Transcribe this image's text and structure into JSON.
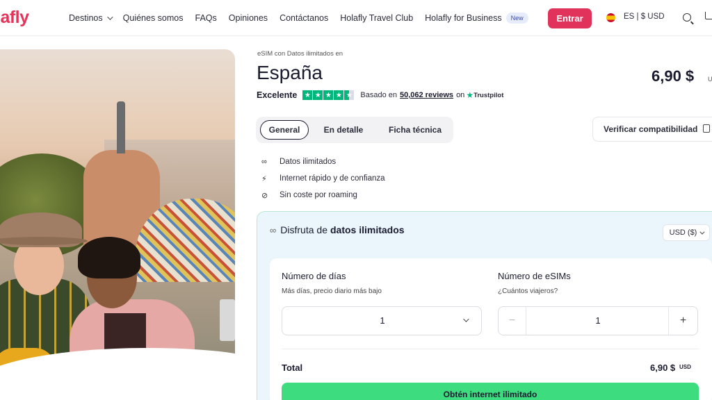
{
  "header": {
    "logo": "lafly",
    "nav": [
      {
        "label": "Destinos",
        "dropdown": true
      },
      {
        "label": "Quiénes somos"
      },
      {
        "label": "FAQs"
      },
      {
        "label": "Opiniones"
      },
      {
        "label": "Contáctanos"
      },
      {
        "label": "Holafly Travel Club"
      },
      {
        "label": "Holafly for Business",
        "badge": "New"
      }
    ],
    "login_label": "Entrar",
    "locale": "ES | $ USD",
    "brand_color": "#e0325a"
  },
  "product": {
    "subtitle": "eSIM con Datos ilimitados en",
    "title": "España",
    "price": "6,90 $",
    "price_unit": "U",
    "rating": {
      "label": "Excelente",
      "stars": 4.5,
      "based_on": "Basado en",
      "reviews": "50,062 reviews",
      "on": "on",
      "provider": "Trustpilot"
    },
    "tabs": [
      {
        "label": "General",
        "active": true
      },
      {
        "label": "En detalle"
      },
      {
        "label": "Ficha técnica"
      }
    ],
    "verify_label": "Verificar compatibilidad",
    "features": [
      {
        "icon": "infinity-icon",
        "label": "Datos ilimitados"
      },
      {
        "icon": "lightning-icon",
        "label": "Internet rápido y de confianza"
      },
      {
        "icon": "no-signal-icon",
        "label": "Sin coste por roaming"
      }
    ]
  },
  "plan": {
    "title_prefix": "Disfruta de",
    "title_bold": "datos ilimitados",
    "currency": "USD ($)",
    "days_label": "Número de días",
    "days_hint": "Más días, precio diario más bajo",
    "days_value": "1",
    "esims_label": "Número de eSIMs",
    "esims_hint": "¿Cuántos viajeros?",
    "esims_value": "1",
    "total_label": "Total",
    "total_value": "6,90 $",
    "total_unit": "USD",
    "cta_label": "Obtén internet ilimitado",
    "cta_color": "#3ddc7e"
  }
}
